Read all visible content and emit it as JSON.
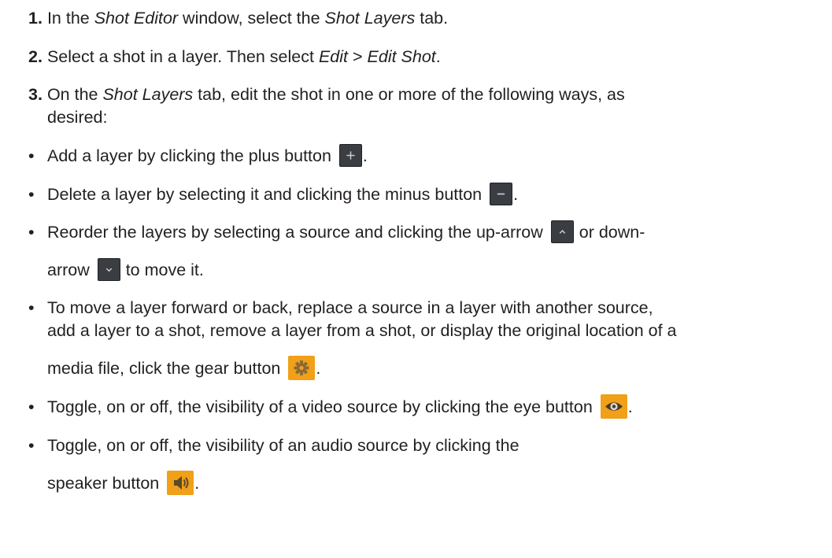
{
  "steps": [
    {
      "num": "1.",
      "parts": [
        "In the ",
        "Shot Editor",
        " window, select the ",
        "Shot Layers",
        " tab."
      ]
    },
    {
      "num": "2.",
      "parts": [
        "Select a shot in a layer. Then select ",
        "Edit",
        " > ",
        "Edit Shot",
        "."
      ]
    },
    {
      "num": "3.",
      "parts": [
        "On the ",
        "Shot Layers",
        " tab, edit the shot in one or more of the following ways, as"
      ],
      "cont": "desired:"
    }
  ],
  "bullets": {
    "bullet_char": "•",
    "add": {
      "before": "Add a layer by clicking the plus button ",
      "after": "."
    },
    "delete": {
      "before": "Delete a layer by selecting it and clicking the minus button ",
      "after": "."
    },
    "reorder": {
      "before": "Reorder the layers by selecting a source and clicking the up-arrow ",
      "mid": " or down-",
      "cont_before": "arrow ",
      "cont_after": " to move it."
    },
    "gear": {
      "line1": "To move a layer forward or back, replace a source in a layer with another source,",
      "line2": "add a layer to a shot, remove a layer from a shot, or display the original location of a",
      "cont_before": "media file, click the gear button ",
      "cont_after": "."
    },
    "eye": {
      "before": "Toggle, on or off, the visibility of a video source by clicking the eye button ",
      "after": "."
    },
    "speaker": {
      "line1": "Toggle, on or off, the visibility of an audio source by clicking the",
      "cont_before": "speaker button ",
      "cont_after": "."
    }
  },
  "icons": {
    "plus": "plus-icon",
    "minus": "minus-icon",
    "up": "chevron-up-icon",
    "down": "chevron-down-icon",
    "gear": "gear-icon",
    "eye": "eye-icon",
    "speaker": "speaker-icon"
  },
  "colors": {
    "text": "#231f20",
    "button_dark": "#3a3d42",
    "button_orange": "#f0a019"
  }
}
